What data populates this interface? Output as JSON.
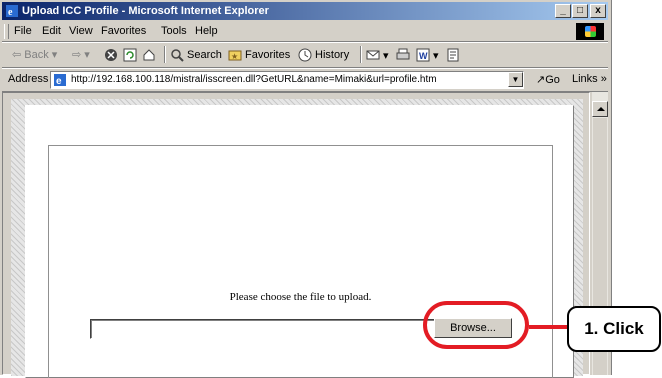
{
  "window": {
    "title": "Upload ICC Profile - Microsoft Internet Explorer"
  },
  "window_controls": [
    "_",
    "□",
    "x"
  ],
  "menu": [
    "File",
    "Edit",
    "View",
    "Favorites",
    "Tools",
    "Help"
  ],
  "toolbar": {
    "back": "Back",
    "search": "Search",
    "favorites": "Favorites",
    "history": "History"
  },
  "address": {
    "label": "Address",
    "url": "http://192.168.100.118/mistral/isscreen.dll?GetURL&name=Mimaki&url=profile.htm",
    "go": "Go",
    "links": "Links »"
  },
  "content": {
    "prompt": "Please choose the file to upload.",
    "file_value": "",
    "browse_label": "Browse..."
  },
  "annotation": {
    "callout": "1. Click",
    "color": "#e31c24"
  }
}
